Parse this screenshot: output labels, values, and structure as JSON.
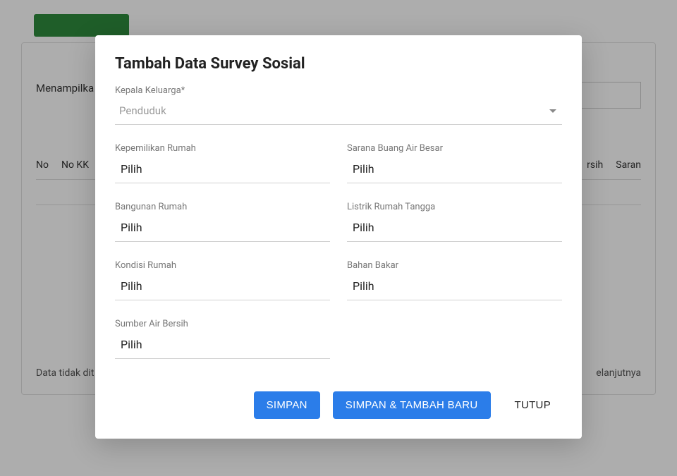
{
  "background": {
    "showing_text": "Menampilka",
    "table_headers": {
      "no": "No",
      "no_kk": "No KK",
      "rsih": "rsih",
      "saran": "Saran"
    },
    "no_data_text": "Data tidak dit",
    "next_text": "elanjutnya"
  },
  "modal": {
    "title": "Tambah Data Survey Sosial",
    "fields": {
      "kepala_keluarga": {
        "label": "Kepala Keluarga*",
        "placeholder": "Penduduk"
      },
      "kepemilikan_rumah": {
        "label": "Kepemilikan Rumah",
        "value": "Pilih"
      },
      "sarana_buang_air": {
        "label": "Sarana Buang Air Besar",
        "value": "Pilih"
      },
      "bangunan_rumah": {
        "label": "Bangunan Rumah",
        "value": "Pilih"
      },
      "listrik_rumah": {
        "label": "Listrik Rumah Tangga",
        "value": "Pilih"
      },
      "kondisi_rumah": {
        "label": "Kondisi Rumah",
        "value": "Pilih"
      },
      "bahan_bakar": {
        "label": "Bahan Bakar",
        "value": "Pilih"
      },
      "sumber_air": {
        "label": "Sumber Air Bersih",
        "value": "Pilih"
      }
    },
    "actions": {
      "save": "SIMPAN",
      "save_add_new": "SIMPAN & TAMBAH BARU",
      "close": "TUTUP"
    }
  }
}
